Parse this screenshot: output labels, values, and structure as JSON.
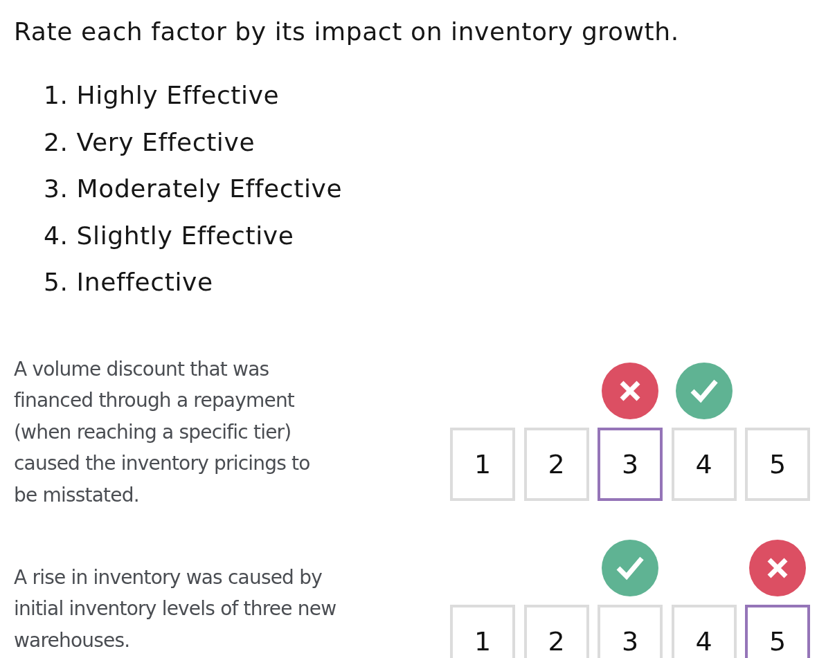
{
  "prompt": "Rate each factor by its impact on inventory growth.",
  "scale": [
    "1. Highly Effective",
    "2. Very Effective",
    "3. Moderately Effective",
    "4. Slightly Effective",
    "5. Ineffective"
  ],
  "items": [
    {
      "text": "A volume discount that was financed through a repayment (when reaching a specific tier) caused the inventory pricings to be misstated.",
      "options": [
        {
          "label": "1",
          "selected": false,
          "correct": false
        },
        {
          "label": "2",
          "selected": false,
          "correct": false
        },
        {
          "label": "3",
          "selected": true,
          "correct": false
        },
        {
          "label": "4",
          "selected": false,
          "correct": true
        },
        {
          "label": "5",
          "selected": false,
          "correct": false
        }
      ]
    },
    {
      "text": "A rise in inventory was caused by initial inventory levels of three new warehouses.",
      "options": [
        {
          "label": "1",
          "selected": false,
          "correct": false
        },
        {
          "label": "2",
          "selected": false,
          "correct": false
        },
        {
          "label": "3",
          "selected": false,
          "correct": true
        },
        {
          "label": "4",
          "selected": false,
          "correct": false
        },
        {
          "label": "5",
          "selected": true,
          "correct": false
        }
      ]
    }
  ]
}
